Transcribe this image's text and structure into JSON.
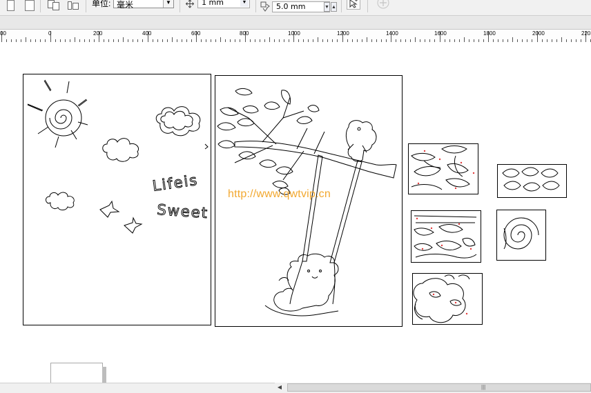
{
  "toolbar": {
    "units_label": "单位:",
    "units_value": "毫米",
    "nudge_value": "1 mm",
    "duplicate_distance": "5.0 mm"
  },
  "ruler": {
    "ticks": [
      "00",
      "0",
      "200",
      "400",
      "600",
      "800",
      "1000",
      "1200",
      "1400",
      "1600",
      "1800",
      "2000",
      "220"
    ]
  },
  "canvas": {
    "watermark": "http://www.qwtvip.cn",
    "text_line_1": "Lifeis",
    "text_line_2": "Sweet"
  },
  "colors": {
    "watermark": "#f2a830",
    "marker": "#e23a3a",
    "outline": "#000000"
  }
}
